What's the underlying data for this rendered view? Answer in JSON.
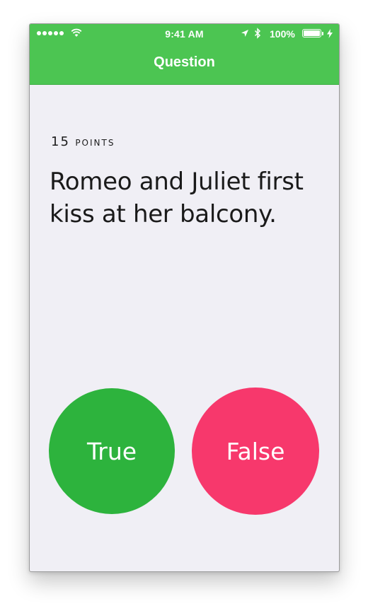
{
  "status_bar": {
    "time": "9:41 AM",
    "battery_percent": "100%",
    "signal_bars": 5,
    "icons": [
      "signal-icon",
      "wifi-icon",
      "location-arrow-icon",
      "bluetooth-icon",
      "battery-icon",
      "charging-bolt-icon"
    ]
  },
  "nav": {
    "title": "Question"
  },
  "question": {
    "points_value": "15",
    "points_label": "points",
    "text": "Romeo and Juliet first kiss at her balcony."
  },
  "answers": {
    "true_label": "True",
    "false_label": "False"
  },
  "colors": {
    "nav_green": "#4cc552",
    "true_green": "#2db33d",
    "false_pink": "#f7386c",
    "background": "#f0eff5"
  }
}
